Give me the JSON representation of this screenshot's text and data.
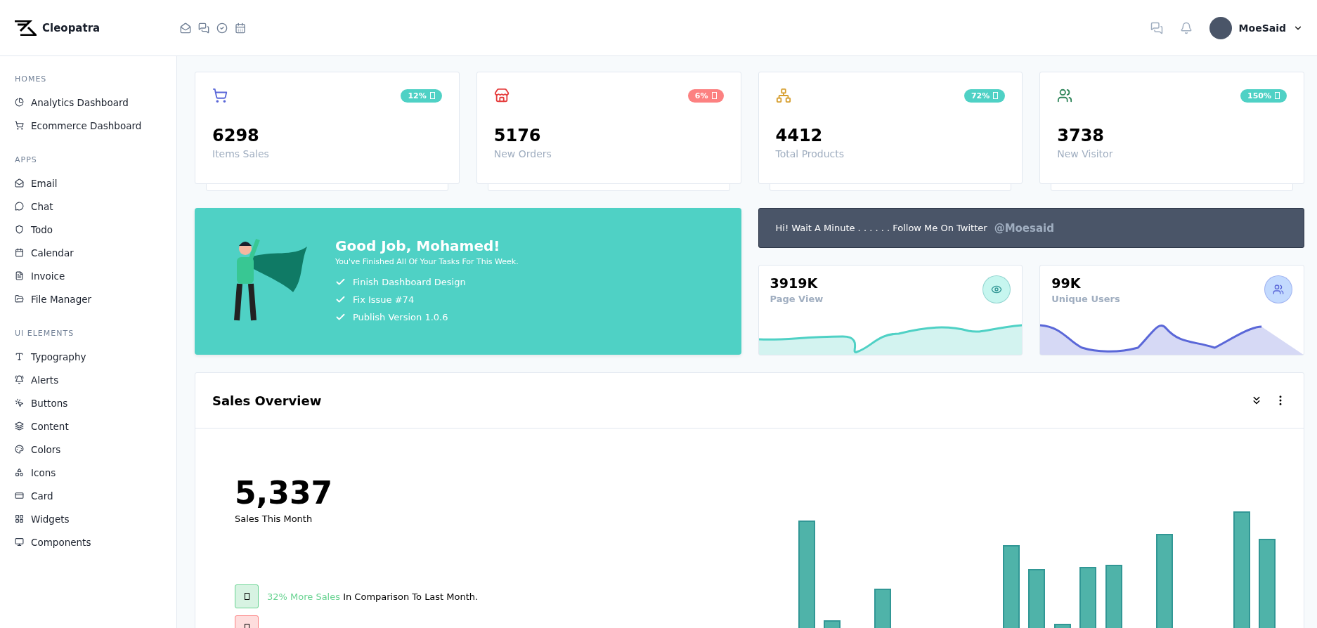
{
  "brand": {
    "name": "Cleopatra"
  },
  "user": {
    "name": "MoeSaid"
  },
  "sidebar": {
    "sections": [
      {
        "title": "HOMES",
        "items": [
          {
            "label": "Analytics Dashboard"
          },
          {
            "label": "Ecommerce Dashboard"
          }
        ]
      },
      {
        "title": "APPS",
        "items": [
          {
            "label": "Email"
          },
          {
            "label": "Chat"
          },
          {
            "label": "Todo"
          },
          {
            "label": "Calendar"
          },
          {
            "label": "Invoice"
          },
          {
            "label": "File Manager"
          }
        ]
      },
      {
        "title": "UI ELEMENTS",
        "items": [
          {
            "label": "Typography"
          },
          {
            "label": "Alerts"
          },
          {
            "label": "Buttons"
          },
          {
            "label": "Content"
          },
          {
            "label": "Colors"
          },
          {
            "label": "Icons"
          },
          {
            "label": "Card"
          },
          {
            "label": "Widgets"
          },
          {
            "label": "Components"
          }
        ]
      }
    ]
  },
  "stats": [
    {
      "value": "6298",
      "label": "Items Sales",
      "badge": "12%",
      "color": "#4fd1c5"
    },
    {
      "value": "5176",
      "label": "New Orders",
      "badge": "6%",
      "color": "#fc8181"
    },
    {
      "value": "4412",
      "label": "Total Products",
      "badge": "72%",
      "color": "#4fd1c5"
    },
    {
      "value": "3738",
      "label": "New Visitor",
      "badge": "150%",
      "color": "#4fd1c5"
    }
  ],
  "hero": {
    "title": "Good Job, Mohamed!",
    "subtitle": "You've Finished All Of Your Tasks For This Week.",
    "tasks": [
      "Finish Dashboard Design",
      "Fix Issue #74",
      "Publish Version 1.0.6"
    ]
  },
  "twitter": {
    "text": "Hi! Wait A Minute . . . . . . Follow Me On Twitter",
    "handle": "@Moesaid"
  },
  "mini_cards": [
    {
      "value": "3919K",
      "label": "Page View",
      "color": "#4fd1c5"
    },
    {
      "value": "99K",
      "label": "Unique Users",
      "color": "#5a67d8"
    }
  ],
  "sales": {
    "title": "Sales Overview",
    "value": "5,337",
    "caption": "Sales This Month",
    "notes": [
      {
        "highlight": "32% More Sales",
        "text": "In Comparison To Last Month.",
        "color": "#68d391"
      },
      {
        "color": "#fc8181"
      }
    ]
  }
}
